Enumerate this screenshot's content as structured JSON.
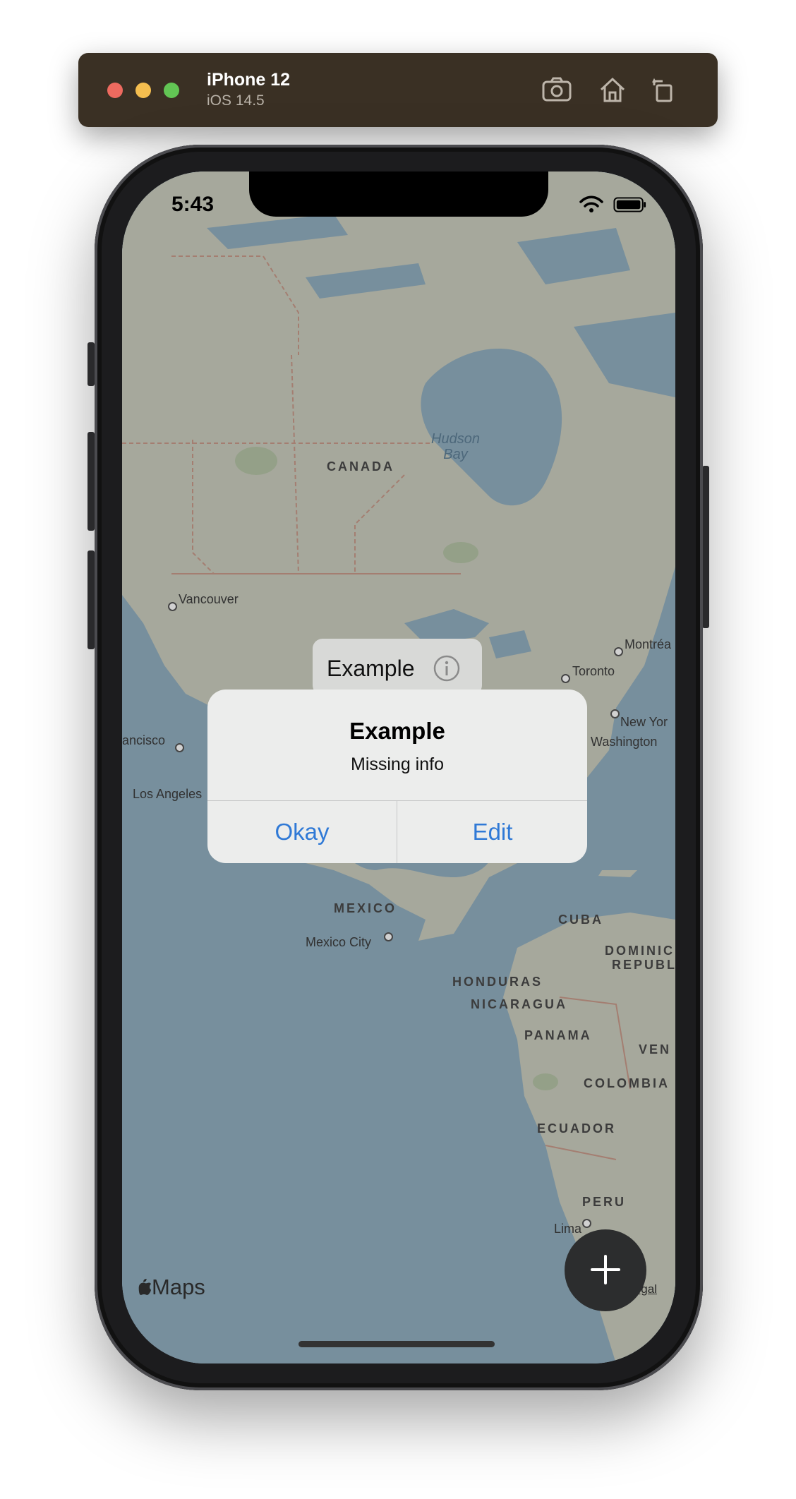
{
  "simulator": {
    "device_name": "iPhone 12",
    "os_version": "iOS 14.5",
    "tools": [
      "camera-icon",
      "home-icon",
      "rotate-icon"
    ]
  },
  "status_bar": {
    "time": "5:43"
  },
  "map": {
    "labels": {
      "hudson_bay": "Hudson\nBay",
      "canada": "CANADA",
      "vancouver": "Vancouver",
      "montreal": "Montréa",
      "toronto": "Toronto",
      "new_york": "New Yor",
      "washington": "Washington",
      "san_francisco": "ancisco",
      "los_angeles": "Los Angeles",
      "mexico": "MEXICO",
      "mexico_city": "Mexico City",
      "cuba": "CUBA",
      "dominican_1": "DOMINIC",
      "dominican_2": "REPUBL",
      "honduras": "HONDURAS",
      "nicaragua": "NICARAGUA",
      "panama": "PANAMA",
      "venezuela": "VEN",
      "colombia": "COLOMBIA",
      "ecuador": "ECUADOR",
      "peru": "PERU",
      "lima": "Lima"
    },
    "attribution": "Maps",
    "legal": "Legal"
  },
  "annotation_callout": {
    "title": "Example"
  },
  "alert": {
    "title": "Example",
    "message": "Missing info",
    "okay_label": "Okay",
    "edit_label": "Edit"
  },
  "colors": {
    "water": "#92afc0",
    "land": "#cbcdbf",
    "accent": "#2f79d6",
    "fab": "#2c2d2e"
  }
}
